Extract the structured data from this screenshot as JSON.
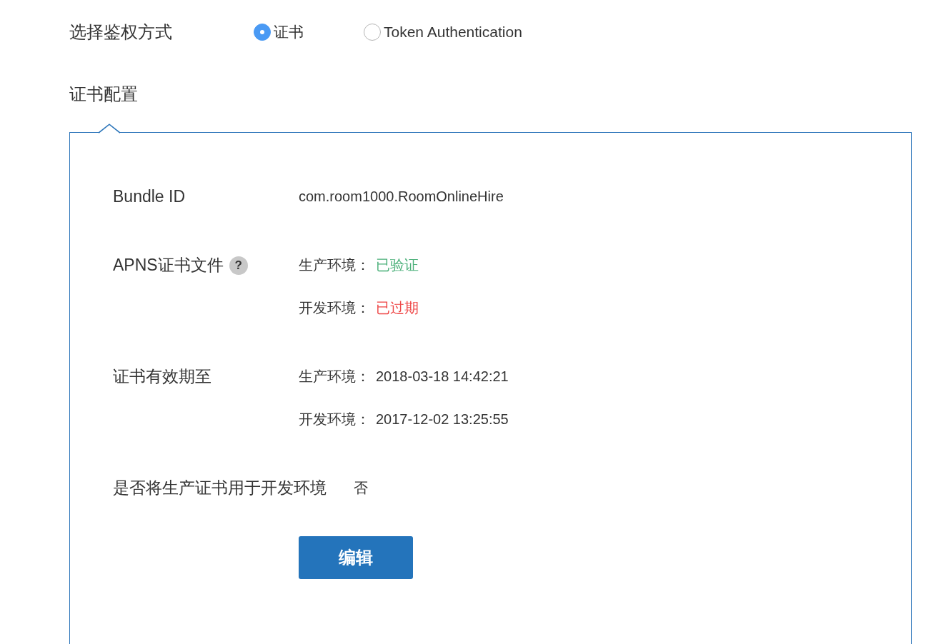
{
  "auth": {
    "label": "选择鉴权方式",
    "options": [
      {
        "label": "证书",
        "selected": true
      },
      {
        "label": "Token Authentication",
        "selected": false
      }
    ]
  },
  "section_title": "证书配置",
  "rows": [
    {
      "kind": "text",
      "label": "Bundle ID",
      "values": [
        {
          "value": "com.room1000.RoomOnlineHire"
        }
      ]
    },
    {
      "kind": "pairs",
      "label": "APNS证书文件",
      "help": "?",
      "values": [
        {
          "env": "生产环境：",
          "value": "已验证",
          "color": "#4cb07a"
        },
        {
          "env": "开发环境：",
          "value": "已过期",
          "color": "#ee4646"
        }
      ]
    },
    {
      "kind": "pairs",
      "label": "证书有效期至",
      "values": [
        {
          "env": "生产环境：",
          "value": "2018-03-18 14:42:21"
        },
        {
          "env": "开发环境：",
          "value": "2017-12-02 13:25:55"
        }
      ]
    },
    {
      "kind": "inline",
      "label": "是否将生产证书用于开发环境",
      "values": [
        {
          "value": "否"
        }
      ]
    }
  ],
  "button": "编辑"
}
